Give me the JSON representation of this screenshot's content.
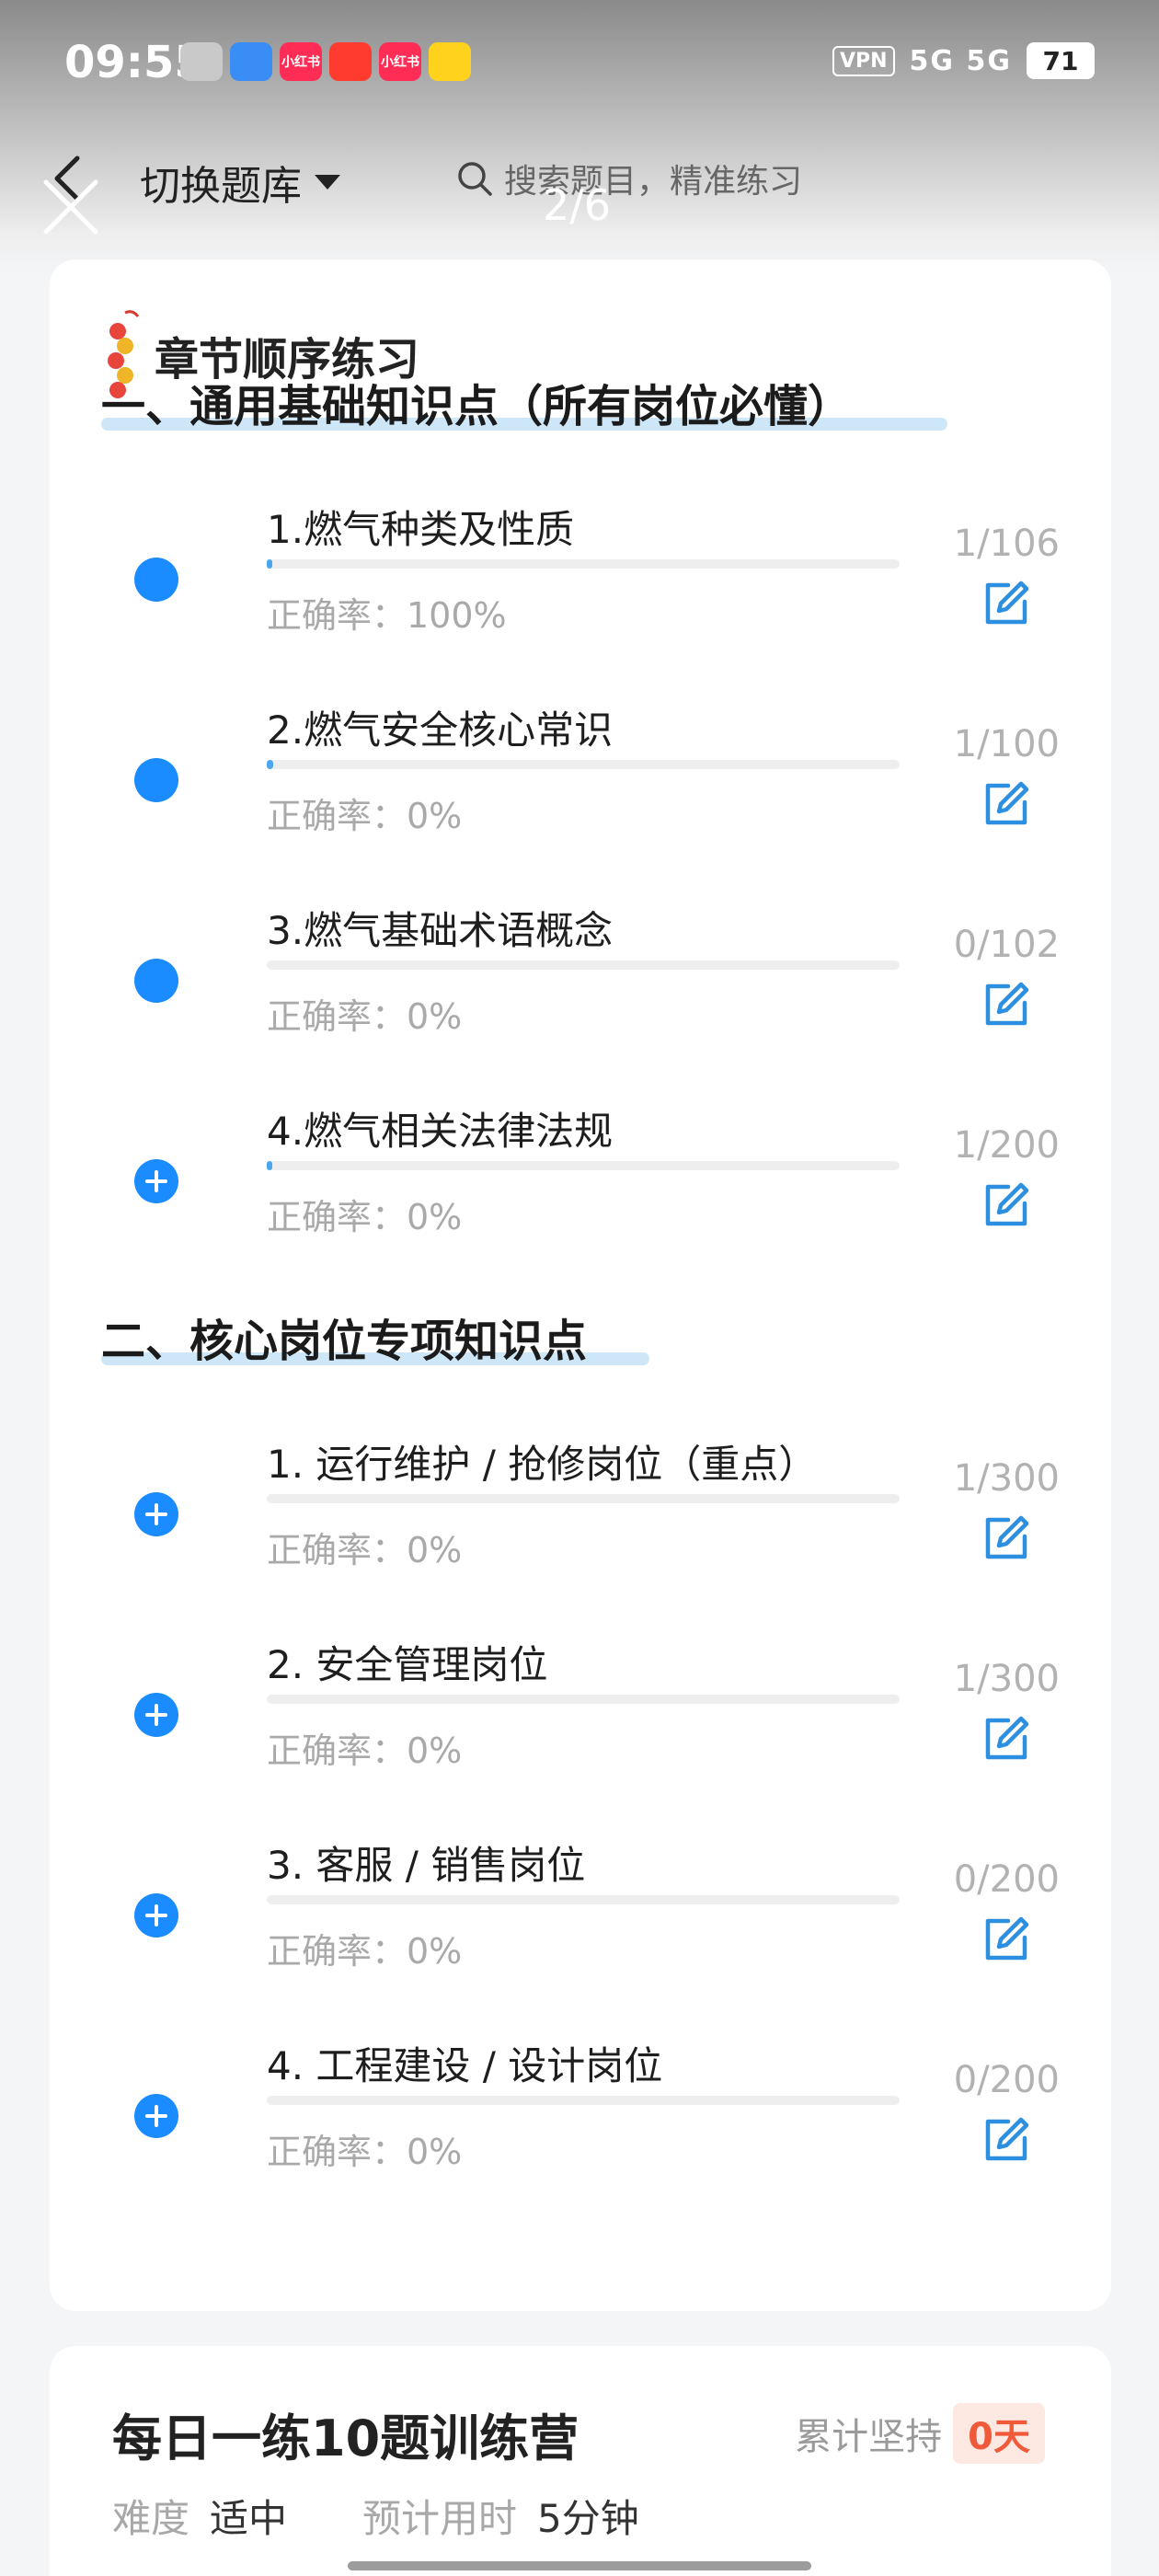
{
  "status_bar": {
    "time": "09:55",
    "app_badges": [
      {
        "label": "",
        "color": "#c9c9c9"
      },
      {
        "label": "",
        "color": "#3a8df5"
      },
      {
        "label": "小红书",
        "color": "#ff2d55"
      },
      {
        "label": "",
        "color": "#ff3b30"
      },
      {
        "label": "小红书",
        "color": "#ff2d55"
      },
      {
        "label": "",
        "color": "#ffd21e"
      }
    ],
    "vpn": "VPN",
    "signal": "5G 5G",
    "battery": "71"
  },
  "header": {
    "switch_bank": "切换题库",
    "search_placeholder": "搜索题目，精准练习",
    "page_indicator": "2/6"
  },
  "card": {
    "title": "章节顺序练习",
    "sections": [
      {
        "title": "一、通用基础知识点（所有岗位必懂）",
        "chapters": [
          {
            "name": "1.燃气种类及性质",
            "accuracy": "正确率：100%",
            "count": "1/106",
            "progress": 0.0094,
            "marker": "dot"
          },
          {
            "name": "2.燃气安全核心常识",
            "accuracy": "正确率：0%",
            "count": "1/100",
            "progress": 0.01,
            "marker": "dot"
          },
          {
            "name": "3.燃气基础术语概念",
            "accuracy": "正确率：0%",
            "count": "0/102",
            "progress": 0,
            "marker": "dot"
          },
          {
            "name": "4.燃气相关法律法规",
            "accuracy": "正确率：0%",
            "count": "1/200",
            "progress": 0.005,
            "marker": "plus"
          }
        ]
      },
      {
        "title": "二、核心岗位专项知识点",
        "chapters": [
          {
            "name": "1. 运行维护 / 抢修岗位（重点）",
            "accuracy": "正确率：0%",
            "count": "1/300",
            "progress": 0,
            "marker": "plus"
          },
          {
            "name": "2. 安全管理岗位",
            "accuracy": "正确率：0%",
            "count": "1/300",
            "progress": 0,
            "marker": "plus"
          },
          {
            "name": "3. 客服 / 销售岗位",
            "accuracy": "正确率：0%",
            "count": "0/200",
            "progress": 0,
            "marker": "plus"
          },
          {
            "name": "4. 工程建设 / 设计岗位",
            "accuracy": "正确率：0%",
            "count": "0/200",
            "progress": 0,
            "marker": "plus"
          }
        ]
      }
    ]
  },
  "camp": {
    "title": "每日一练10题训练营",
    "streak_label": "累计坚持",
    "streak_days": "0天",
    "difficulty_label": "难度",
    "difficulty_value": "适中",
    "time_label": "预计用时",
    "time_value": "5分钟"
  },
  "colors": {
    "accent": "#1a8cff",
    "progress": "#4aa6f0",
    "streak": "#f05a3a"
  },
  "icons": {
    "close": "close-icon",
    "back": "chevron-left-icon",
    "search": "search-icon",
    "edit": "edit-icon",
    "firecracker": "firecracker-icon"
  }
}
